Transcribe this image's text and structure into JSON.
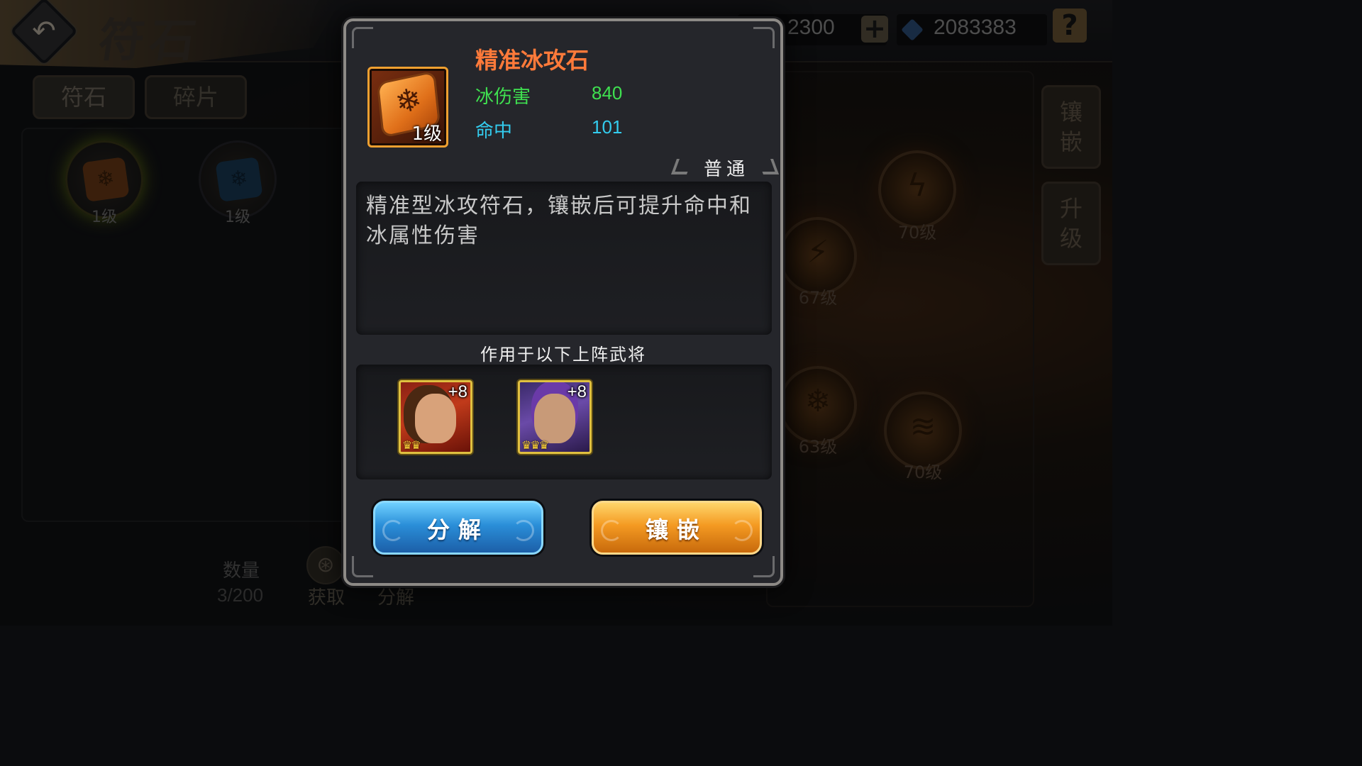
{
  "header": {
    "title": "符石",
    "currency_1": "2300",
    "currency_2": "2083383",
    "plus_label": "+",
    "help_label": "?"
  },
  "tabs": [
    {
      "label": "符石"
    },
    {
      "label": "碎片"
    }
  ],
  "inventory": {
    "runes": [
      {
        "level": "1级",
        "color": "#e0701a"
      },
      {
        "level": "1级",
        "color": "#2a7ac0"
      }
    ],
    "quantity_label": "数量",
    "quantity_value": "3/200",
    "get_label": "获取",
    "decompose_label": "分解"
  },
  "socket_panel": {
    "slots": [
      {
        "level": "70级",
        "icon": "lightning-icon"
      },
      {
        "level": "67级",
        "icon": "slash-icon"
      },
      {
        "level": "63级",
        "icon": "snowflake-icon"
      },
      {
        "level": "70级",
        "icon": "tornado-icon"
      }
    ],
    "side_buttons": [
      "镶嵌",
      "升级"
    ]
  },
  "popup": {
    "item_name": "精准冰攻石",
    "item_level": "1级",
    "stats": [
      {
        "label": "冰伤害",
        "value": "840",
        "color": "#3fe050"
      },
      {
        "label": "命中",
        "value": "101",
        "color": "#33ccee"
      }
    ],
    "rarity": "普通",
    "description": "精准型冰攻符石，镶嵌后可提升命中和冰属性伤害",
    "heroes_title": "作用于以下上阵武将",
    "heroes": [
      {
        "plus": "+8",
        "crowns": "♛♛"
      },
      {
        "plus": "+8",
        "crowns": "♛♛♛"
      }
    ],
    "buttons": {
      "decompose": "分解",
      "inlay": "镶嵌"
    }
  },
  "colors": {
    "item_name": "#ff7a3a",
    "button_blue": "#2a8ed8",
    "button_orange": "#f49a22"
  }
}
